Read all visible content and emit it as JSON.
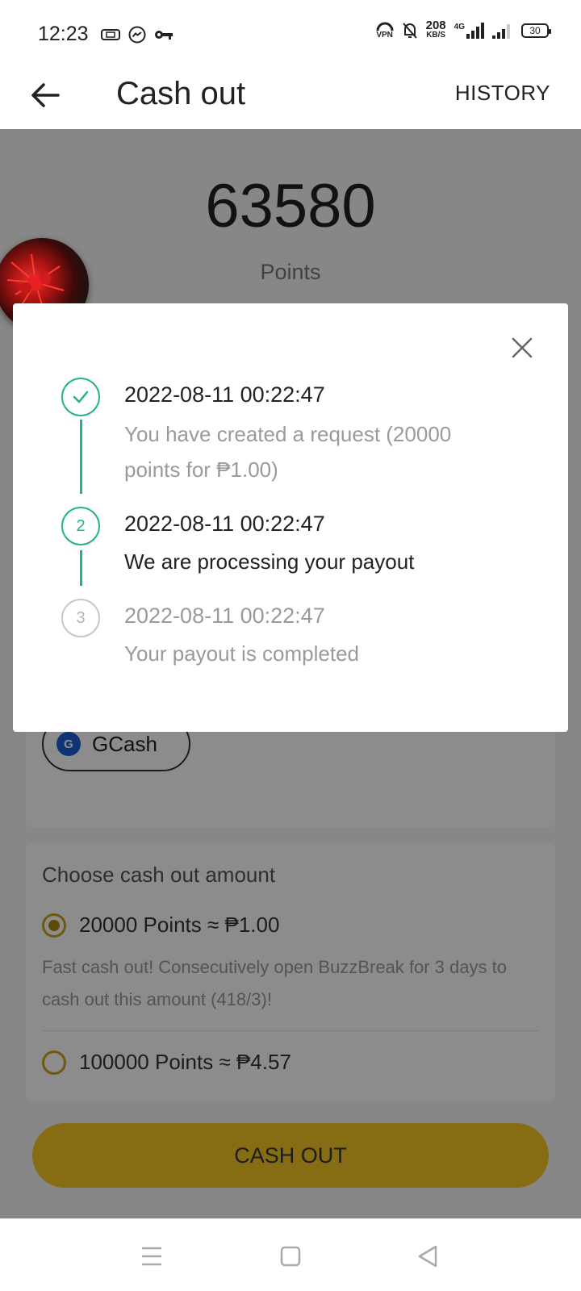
{
  "status_bar": {
    "time": "12:23",
    "network_speed_value": "208",
    "network_speed_unit": "KB/S",
    "network_type": "4G",
    "vpn_label": "VPN",
    "battery_level": "30",
    "icons": [
      "messenger-icon",
      "key-icon",
      "vpn-icon",
      "bell-off-icon",
      "signal-icon",
      "battery-icon"
    ]
  },
  "app_bar": {
    "title": "Cash out",
    "history_label": "HISTORY"
  },
  "balance": {
    "points_value": "63580",
    "points_label": "Points"
  },
  "payment_method": {
    "selected": "GCash",
    "logo_letter": "G"
  },
  "amount_section": {
    "title": "Choose cash out amount",
    "options": [
      {
        "label": "20000 Points ≈ ₱1.00",
        "selected": true,
        "description": "Fast cash out! Consecutively open BuzzBreak for 3 days to cash out this amount (418/3)!"
      },
      {
        "label": "100000 Points ≈ ₱4.57",
        "selected": false
      }
    ]
  },
  "cash_out_button": "CASH OUT",
  "dialog": {
    "steps": [
      {
        "number": "1",
        "state": "done",
        "time": "2022-08-11 00:22:47",
        "description": "You have created a request (20000 points for ₱1.00)"
      },
      {
        "number": "2",
        "state": "active",
        "time": "2022-08-11 00:22:47",
        "description": "We are processing your payout"
      },
      {
        "number": "3",
        "state": "pending",
        "time": "2022-08-11 00:22:47",
        "description": "Your payout is completed"
      }
    ]
  },
  "colors": {
    "accent_green": "#21b48e",
    "button_yellow": "#f5c521",
    "scrim": "rgba(0,0,0,0.45)"
  }
}
